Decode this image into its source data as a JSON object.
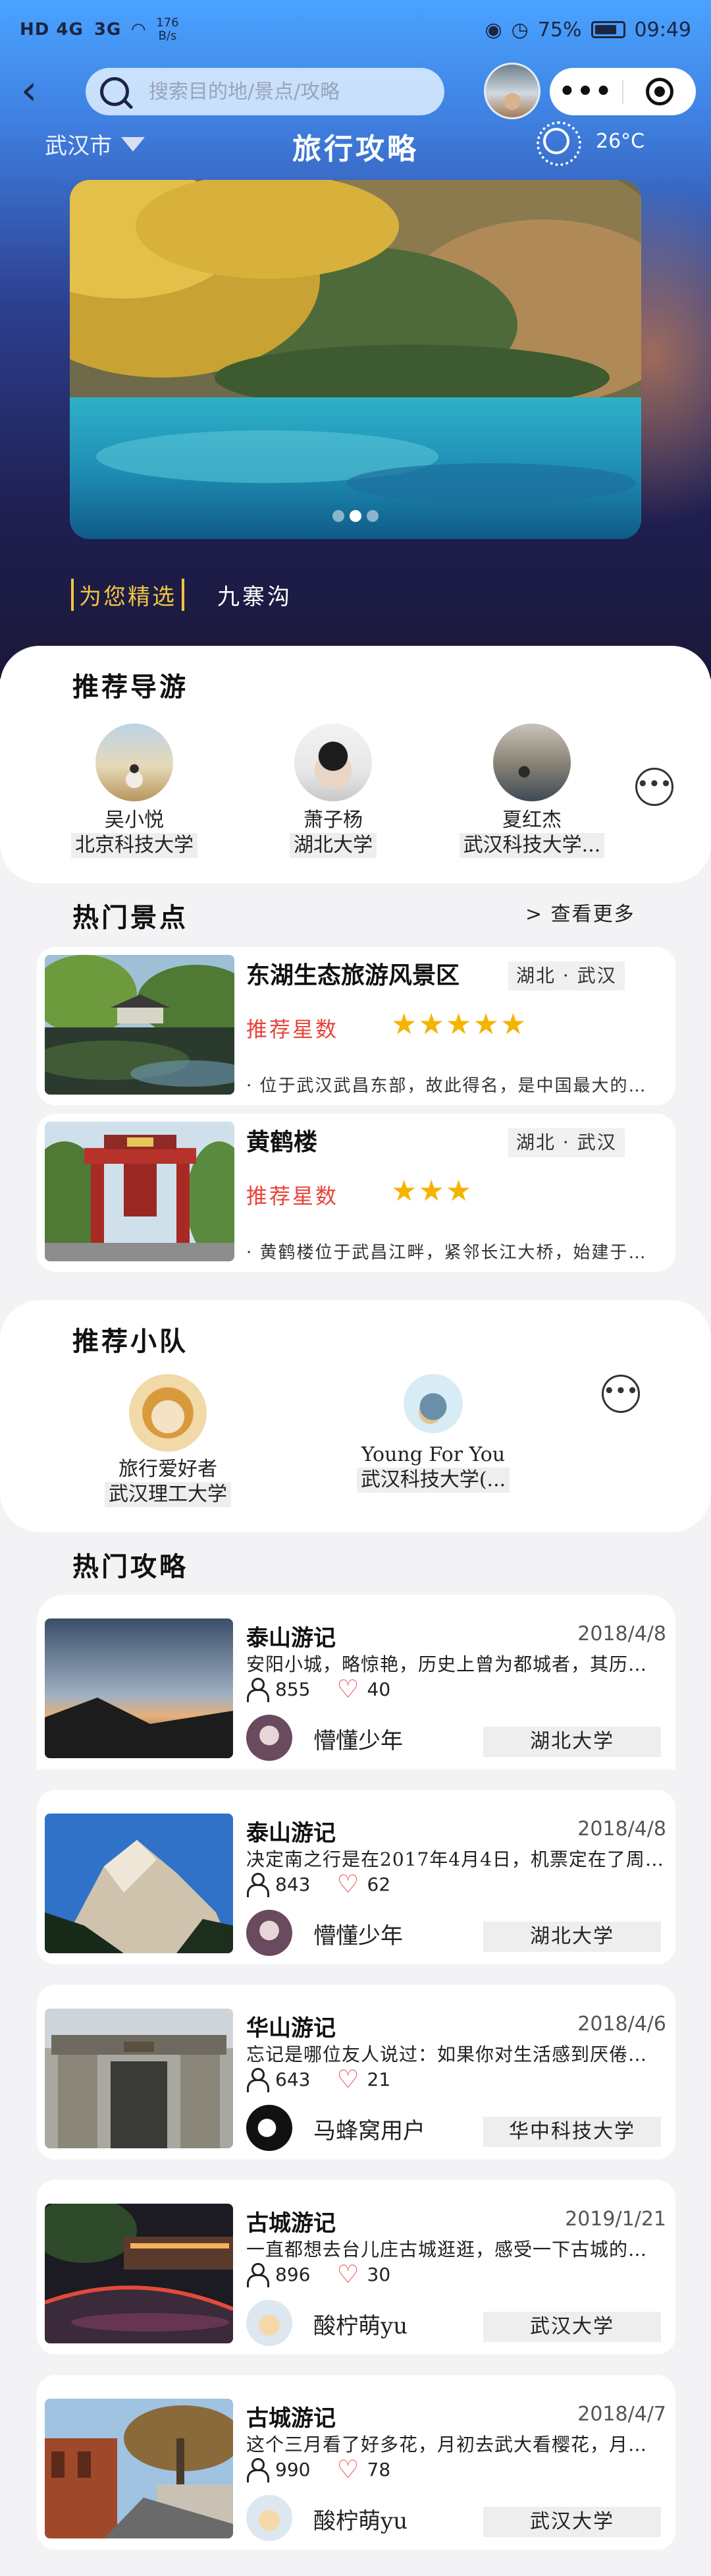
{
  "status_bar": {
    "network": "HD 4G",
    "signal": "3G",
    "speed_value": "176",
    "speed_unit": "B/s",
    "battery": "75%",
    "time": "09:49"
  },
  "nav": {
    "back_icon": "back-arrow-icon",
    "search_placeholder": "搜索目的地/景点/攻略",
    "more_label": "•••",
    "target_icon": "target-icon"
  },
  "header": {
    "city": "武汉市",
    "title": "旅行攻略",
    "temperature": "26°C"
  },
  "banner": {
    "dots": 3,
    "active_dot": 2
  },
  "featured": {
    "tag": "为您精选",
    "place": "九寨沟"
  },
  "guides": {
    "title": "推荐导游",
    "items": [
      {
        "name": "吴小悦",
        "school": "北京科技大学"
      },
      {
        "name": "萧子杨",
        "school": "湖北大学"
      },
      {
        "name": "夏红杰",
        "school": "武汉科技大学..."
      }
    ],
    "more_label": "•••"
  },
  "spots": {
    "title": "热门景点",
    "see_more": "> 查看更多",
    "star_label": "推荐星数",
    "items": [
      {
        "name": "东湖生态旅游风景区",
        "location": "湖北 · 武汉",
        "stars": "★★★★★",
        "rating": 5,
        "desc": "· 位于武汉武昌东部，故此得名，是中国最大的城中湖"
      },
      {
        "name": "黄鹤楼",
        "location": "湖北 · 武汉",
        "stars": "★★★",
        "rating": 3,
        "desc": "· 黄鹤楼位于武昌江畔，紧邻长江大桥，始建于三国时期"
      }
    ]
  },
  "teams": {
    "title": "推荐小队",
    "items": [
      {
        "name": "旅行爱好者",
        "school": "武汉理工大学"
      },
      {
        "name": "Young For You",
        "school": "武汉科技大学(..."
      }
    ],
    "more_label": "•••"
  },
  "articles": {
    "title": "热门攻略",
    "items": [
      {
        "title": "泰山游记",
        "date": "2018/4/8",
        "excerpt": "安阳小城，略惊艳，历史上曾为都城者，其历史厚重",
        "views": "855",
        "likes": "40",
        "author": "懵懂少年",
        "school": "湖北大学"
      },
      {
        "title": "泰山游记",
        "date": "2018/4/8",
        "excerpt": "决定南之行是在2017年4月4日，机票定在了周五晚上",
        "views": "843",
        "likes": "62",
        "author": "懵懂少年",
        "school": "湖北大学"
      },
      {
        "title": "华山游记",
        "date": "2018/4/6",
        "excerpt": "忘记是哪位友人说过：如果你对生活感到厌倦了，就",
        "views": "643",
        "likes": "21",
        "author": "马蜂窝用户",
        "school": "华中科技大学"
      },
      {
        "title": "古城游记",
        "date": "2019/1/21",
        "excerpt": "一直都想去台儿庄古城逛逛，感受一下古城的魅力",
        "views": "896",
        "likes": "30",
        "author": "酸柠萌yu",
        "school": "武汉大学"
      },
      {
        "title": "古城游记",
        "date": "2018/4/7",
        "excerpt": "这个三月看了好多花，月初去武大看樱花，月中去了",
        "views": "990",
        "likes": "78",
        "author": "酸柠萌yu",
        "school": "武汉大学"
      }
    ]
  },
  "colors": {
    "accent_gold": "#f2c440",
    "star": "#f5b400",
    "star_label": "#e8413a",
    "heart": "#e84850"
  }
}
